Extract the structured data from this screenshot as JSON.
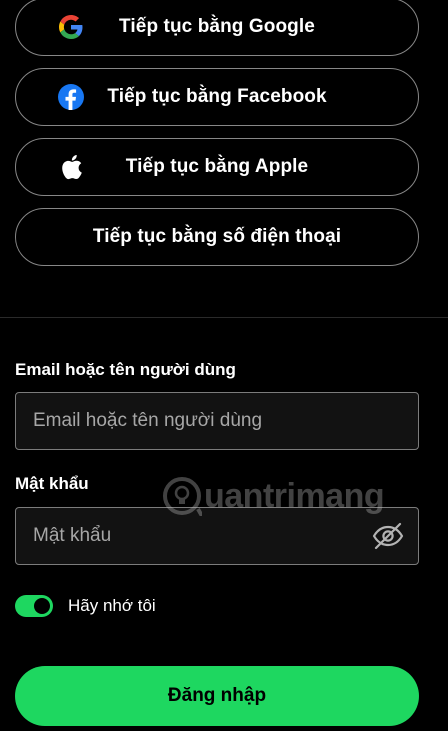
{
  "social_buttons": {
    "google": {
      "label": "Tiếp tục bằng Google",
      "icon": "google-icon"
    },
    "facebook": {
      "label": "Tiếp tục bằng Facebook",
      "icon": "facebook-icon"
    },
    "apple": {
      "label": "Tiếp tục bằng Apple",
      "icon": "apple-icon"
    },
    "phone": {
      "label": "Tiếp tục bằng số điện thoại"
    }
  },
  "form": {
    "email": {
      "label": "Email hoặc tên người dùng",
      "placeholder": "Email hoặc tên người dùng",
      "value": ""
    },
    "password": {
      "label": "Mật khẩu",
      "placeholder": "Mật khẩu",
      "value": "",
      "visibility_icon": "eye-off-icon"
    },
    "remember": {
      "label": "Hãy nhớ tôi",
      "checked": true
    },
    "submit_label": "Đăng nhập"
  },
  "watermark": {
    "text": "uantrimang"
  },
  "colors": {
    "background": "#000000",
    "accent": "#1ed760",
    "field_background": "#121212",
    "border": "#878787",
    "facebook_blue": "#1877f2"
  }
}
